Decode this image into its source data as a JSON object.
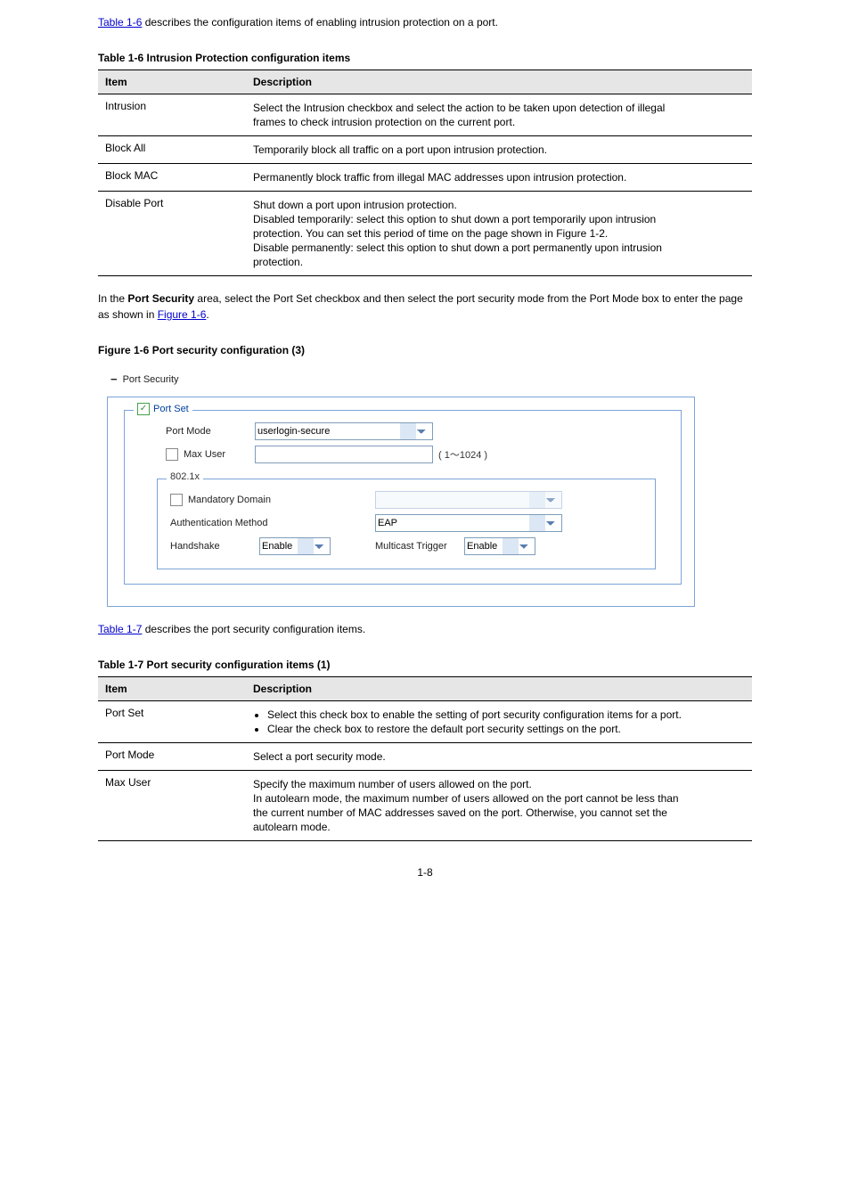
{
  "table1": {
    "link": "Table 1-6",
    "caption": "describes the configuration items of enabling intrusion protection on a port.",
    "caption_full": "Intrusion Protection configuration items",
    "header_item": "Item",
    "header_desc": "Description",
    "rows": [
      {
        "item": "Intrusion",
        "lines": [
          "Select the Intrusion checkbox and select the action to be taken upon detection of illegal",
          " frames to check intrusion protection on the current port."
        ]
      },
      {
        "item": "Block All",
        "lines": [
          "Temporarily block all traffic on a port upon intrusion protection."
        ]
      },
      {
        "item": "Block MAC",
        "lines": [
          "Permanently block traffic from illegal MAC addresses upon intrusion protection."
        ]
      },
      {
        "item": "Disable Port",
        "lines": [
          "Shut down a port upon intrusion protection.",
          " ",
          "Disabled temporarily: select this option to shut down a port temporarily upon intrusion",
          "protection. You can set this period of time on the page shown in Figure 1-2.",
          " ",
          "Disable permanently: select this option to shut down a port permanently upon intrusion",
          "protection."
        ]
      }
    ]
  },
  "mid_text": {
    "before_bold": "In the ",
    "bold": "Port Security",
    "after_bold": " area, select the Port Set checkbox and then select the port security mode from the Port Mode box to enter the page as shown in ",
    "figref": "Figure 1-6",
    "tail": "."
  },
  "figure": {
    "caption_label": "Figure 1-6",
    "caption_text": "Port security configuration (3)",
    "title_label": "Port Security",
    "portset_checkbox_checked": true,
    "portset_label": "Port Set",
    "portmode_label": "Port Mode",
    "portmode_value": "userlogin-secure",
    "maxuser_label": "Max User",
    "maxuser_hint": "( 1～1024 )",
    "inner_legend": "802.1x",
    "mandatory_domain_label": "Mandatory Domain",
    "authmethod_label": "Authentication Method",
    "authmethod_value": "EAP",
    "handshake_label": "Handshake",
    "handshake_value": "Enable",
    "multicast_label": "Multicast Trigger",
    "multicast_value": "Enable"
  },
  "table2": {
    "link": "Table 1-7",
    "caption": "describes the port security configuration items.",
    "caption_full": "Port security configuration items (1)",
    "header_item": "Item",
    "header_desc": "Description",
    "rows": [
      {
        "item": "Port Set",
        "bullets": [
          "Select this check box to enable the setting of port security configuration items for a port.",
          "Clear the check box to restore the default port security settings on the port."
        ]
      },
      {
        "item": "Port Mode",
        "lines": [
          "Select a port security mode."
        ]
      },
      {
        "item": "Max User",
        "lines": [
          "Specify the maximum number of users allowed on the port.",
          " ",
          "In autolearn mode, the maximum number of users allowed on the port cannot be less than",
          "the current number of MAC addresses saved on the port. Otherwise, you cannot set the",
          "autolearn mode."
        ]
      }
    ]
  },
  "page_number": "1-8"
}
